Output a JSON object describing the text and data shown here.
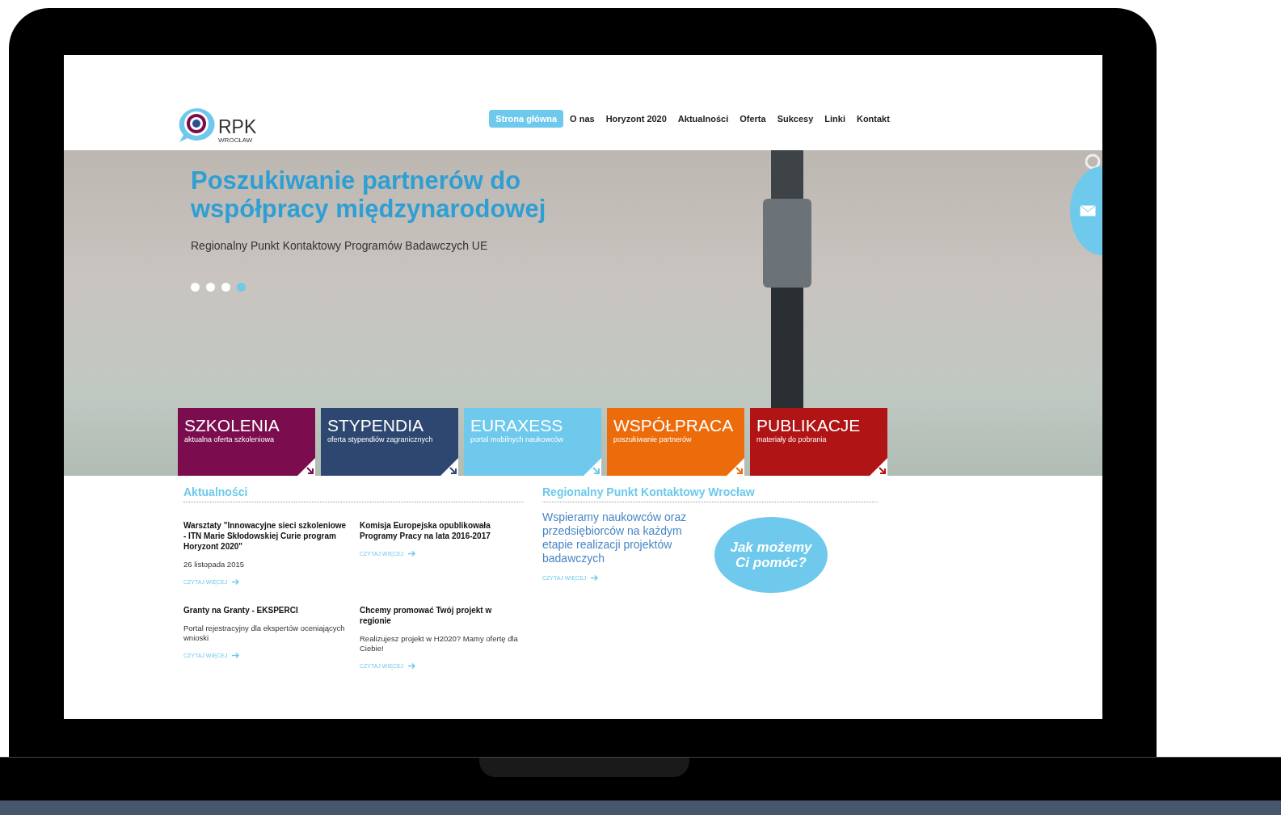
{
  "logo": {
    "name": "RPK",
    "city": "WROCŁAW"
  },
  "nav": [
    {
      "label": "Strona główna",
      "selected": true
    },
    {
      "label": "O nas",
      "selected": false
    },
    {
      "label": "Horyzont 2020",
      "selected": false
    },
    {
      "label": "Aktualności",
      "selected": false
    },
    {
      "label": "Oferta",
      "selected": false
    },
    {
      "label": "Sukcesy",
      "selected": false
    },
    {
      "label": "Linki",
      "selected": false
    },
    {
      "label": "Kontakt",
      "selected": false
    }
  ],
  "slider": {
    "title": "Poszukiwanie partnerów do współpracy międzynarodowej",
    "subtitle": "Regionalny Punkt Kontaktowy Programów Badawczych UE",
    "dots": [
      {
        "selected": false
      },
      {
        "selected": false
      },
      {
        "selected": false
      },
      {
        "selected": true
      }
    ]
  },
  "tiles": [
    {
      "title": "SZKOLENIA",
      "subtitle": "aktualna oferta szkoleniowa",
      "color": "#7b0d4f"
    },
    {
      "title": "STYPENDIA",
      "subtitle": "oferta stypendiów zagranicznych",
      "color": "#2d4770"
    },
    {
      "title": "EURAXESS",
      "subtitle": "portal mobilnych naukowców",
      "color": "#6ec9ec"
    },
    {
      "title": "WSPÓŁPRACA",
      "subtitle": "poszukiwanie partnerów",
      "color": "#ec6c0c"
    },
    {
      "title": "PUBLIKACJE",
      "subtitle": "materiały do pobrania",
      "color": "#b01414"
    }
  ],
  "news": {
    "heading": "Aktualności",
    "items": [
      {
        "title": "Warsztaty \"Innowacyjne sieci szkoleniowe - ITN Marie Skłodowskiej Curie program Horyzont 2020\"",
        "date": "26 listopada 2015",
        "link": "CZYTAJ WIĘCEJ"
      },
      {
        "title": "Komisja Europejska opublikowała Programy Pracy na lata 2016-2017",
        "link": "CZYTAJ WIĘCEJ"
      },
      {
        "title": "Granty na Granty - EKSPERCI",
        "excerpt": "Portal rejestracyjny dla ekspertów oceniających wnioski",
        "link": "CZYTAJ WIĘCEJ"
      },
      {
        "title": "Chcemy promować Twój projekt w regionie",
        "excerpt": "Realizujesz projekt w H2020? Mamy ofertę dla Ciebie!",
        "link": "CZYTAJ WIĘCEJ"
      }
    ]
  },
  "about": {
    "heading": "Regionalny Punkt Kontaktowy Wrocław",
    "text": "Wspieramy naukowców oraz przedsiębiorców na każdym etapie realizacji projektów badawczych",
    "link": "CZYTAJ WIĘCEJ",
    "bubble": "Jak możemy Ci pomóc?"
  }
}
